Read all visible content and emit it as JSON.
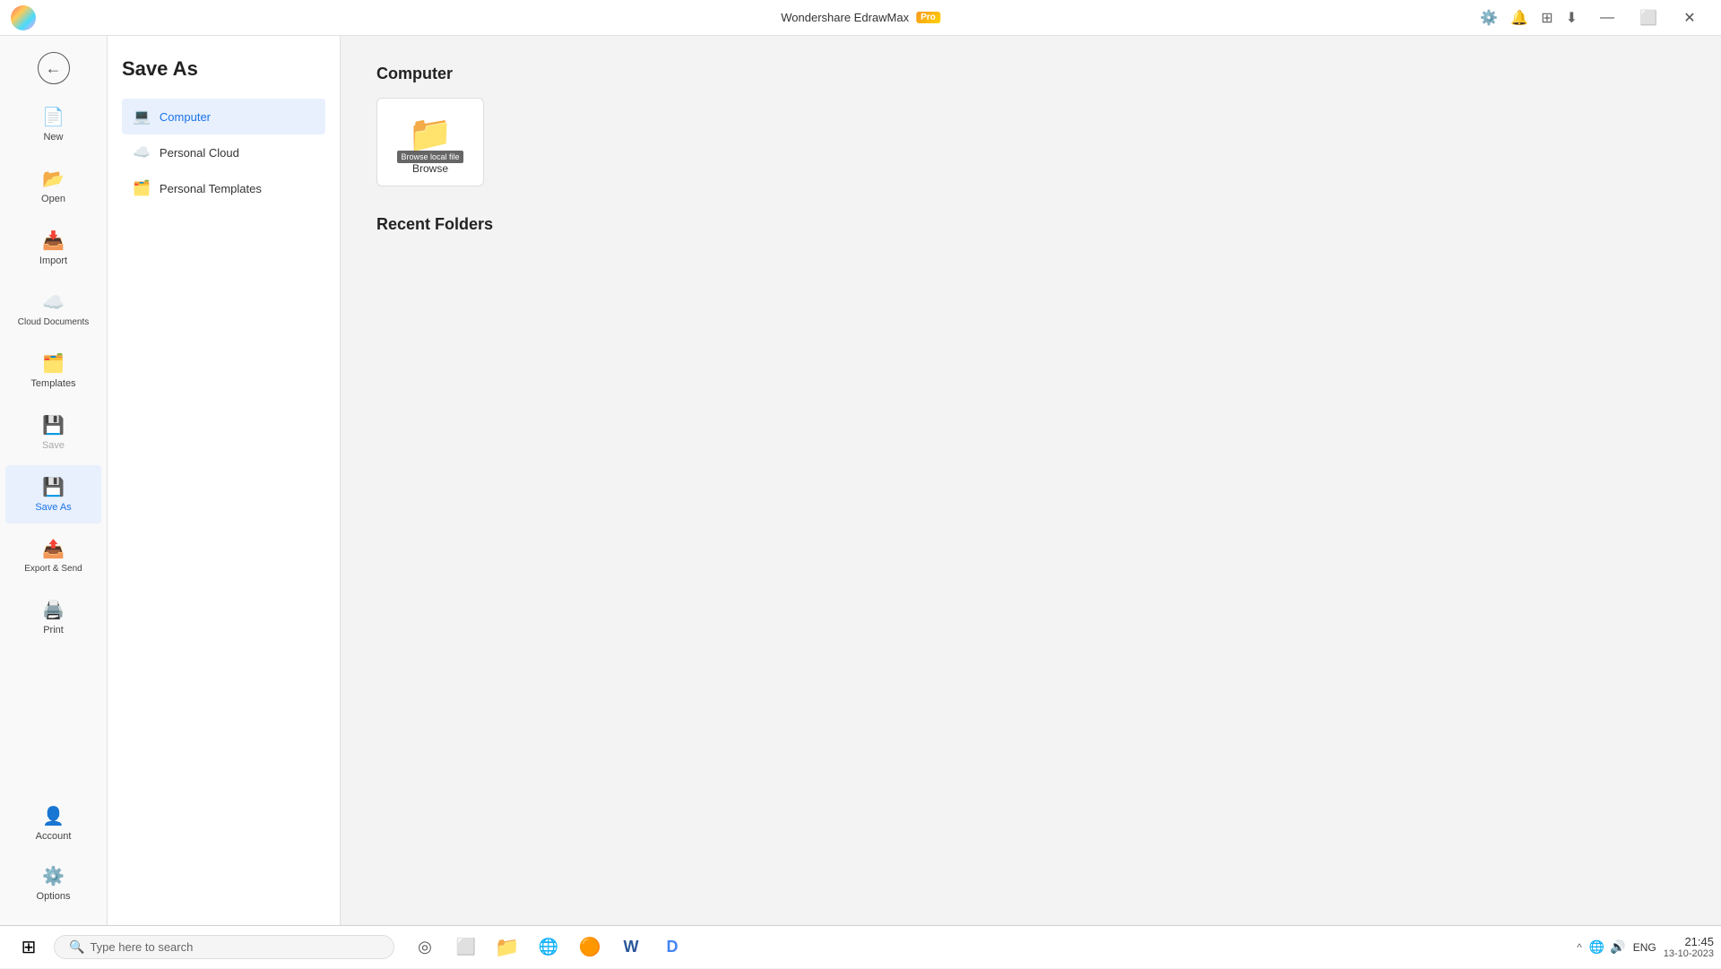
{
  "titlebar": {
    "app_name": "Wondershare EdrawMax",
    "pro_label": "Pro",
    "controls": {
      "minimize": "—",
      "maximize": "⬜",
      "close": "✕"
    },
    "icons": [
      "⚙",
      "🔔",
      "⊞",
      "⬇"
    ]
  },
  "nav": {
    "back_icon": "←",
    "items": [
      {
        "id": "new",
        "label": "New",
        "icon": "📄",
        "has_plus": true,
        "active": false,
        "disabled": false
      },
      {
        "id": "open",
        "label": "Open",
        "icon": "📂",
        "active": false,
        "disabled": false
      },
      {
        "id": "import",
        "label": "Import",
        "icon": "📥",
        "active": false,
        "disabled": false
      },
      {
        "id": "cloud",
        "label": "Cloud Documents",
        "icon": "☁",
        "active": false,
        "disabled": false
      },
      {
        "id": "templates",
        "label": "Templates",
        "icon": "🗂",
        "active": false,
        "disabled": false
      },
      {
        "id": "save",
        "label": "Save",
        "icon": "💾",
        "active": false,
        "disabled": true
      },
      {
        "id": "saveas",
        "label": "Save As",
        "icon": "💾",
        "active": true,
        "disabled": false
      },
      {
        "id": "export",
        "label": "Export & Send",
        "icon": "📤",
        "active": false,
        "disabled": false
      },
      {
        "id": "print",
        "label": "Print",
        "icon": "🖨",
        "active": false,
        "disabled": false
      }
    ],
    "bottom_items": [
      {
        "id": "account",
        "label": "Account",
        "icon": "👤"
      },
      {
        "id": "options",
        "label": "Options",
        "icon": "⚙"
      }
    ]
  },
  "panel": {
    "title": "Save As",
    "items": [
      {
        "id": "computer",
        "label": "Computer",
        "icon": "💻",
        "active": true
      },
      {
        "id": "personal-cloud",
        "label": "Personal Cloud",
        "icon": "☁",
        "active": false
      },
      {
        "id": "personal-templates",
        "label": "Personal Templates",
        "icon": "🗂",
        "active": false
      }
    ]
  },
  "main": {
    "section_title": "Computer",
    "browse_card": {
      "folder_icon": "📁",
      "overlay_label": "Browse local file",
      "label": "Browse"
    },
    "recent_folders_title": "Recent Folders"
  },
  "taskbar": {
    "start_icon": "⊞",
    "search_placeholder": "Type here to search",
    "search_icon": "🔍",
    "apps": [
      {
        "icon": "◎",
        "label": "search"
      },
      {
        "icon": "⬜",
        "label": "task-view"
      },
      {
        "icon": "📁",
        "label": "file-explorer"
      },
      {
        "icon": "🌐",
        "label": "edge"
      },
      {
        "icon": "🟠",
        "label": "chrome"
      },
      {
        "icon": "W",
        "label": "word"
      },
      {
        "icon": "D",
        "label": "edrawmax"
      }
    ],
    "tray": {
      "chevron": "^",
      "lang": "ENG",
      "time": "21:45",
      "date": "13-10-2023"
    }
  }
}
